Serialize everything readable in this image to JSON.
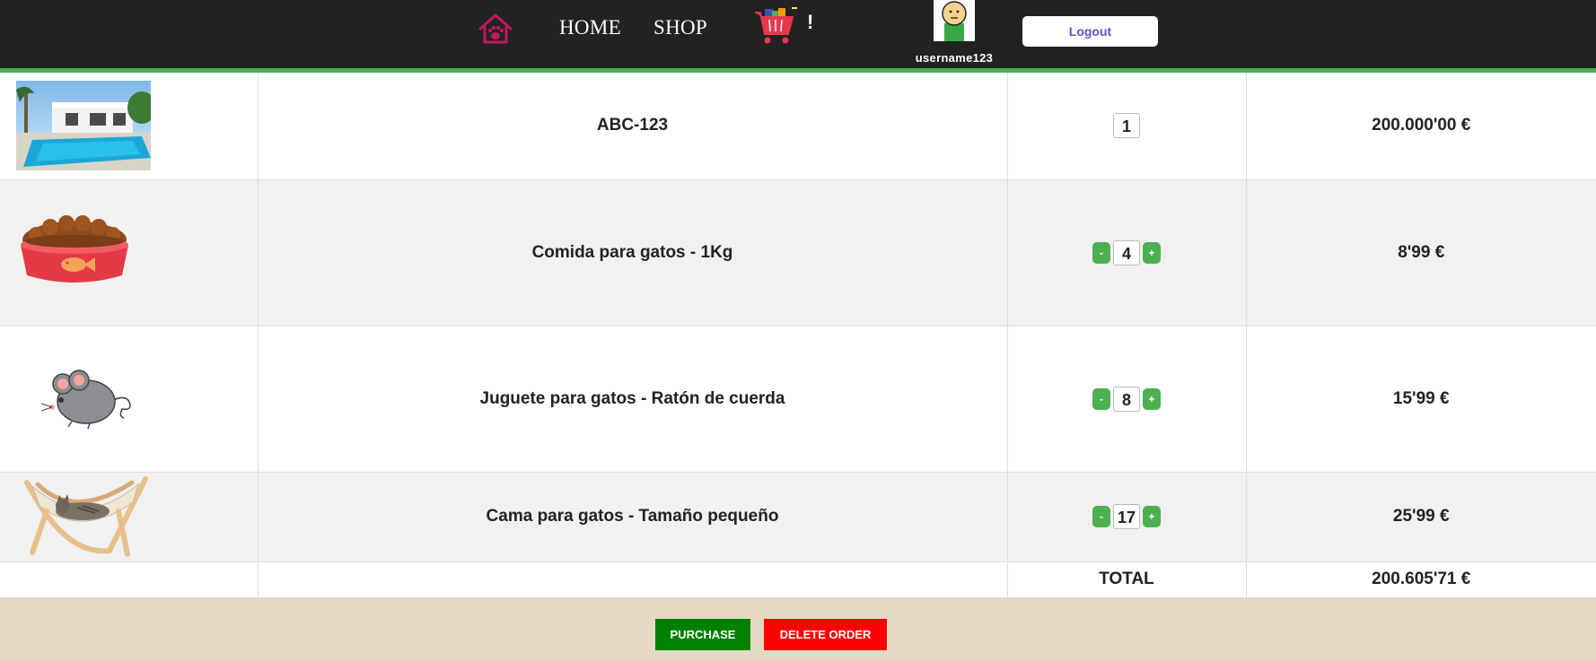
{
  "nav": {
    "logo_icon": "home-paw-icon",
    "home_label": "HOME",
    "shop_label": "SHOP",
    "cart_icon": "shopping-cart-icon",
    "cart_alert": "!",
    "username": "username123",
    "logout_label": "Logout"
  },
  "cart": {
    "items": [
      {
        "image": "pool-house-image",
        "name": "ABC-123",
        "quantity": "1",
        "price": "200.000'00 €",
        "editable": false
      },
      {
        "image": "cat-food-bowl-image",
        "name": "Comida para gatos - 1Kg",
        "quantity": "4",
        "price": "8'99 €",
        "editable": true
      },
      {
        "image": "toy-mouse-image",
        "name": "Juguete para gatos - Ratón de cuerda",
        "quantity": "8",
        "price": "15'99 €",
        "editable": true
      },
      {
        "image": "cat-hammock-image",
        "name": "Cama para gatos - Tamaño pequeño",
        "quantity": "17",
        "price": "25'99 €",
        "editable": true
      }
    ],
    "decrement_label": "-",
    "increment_label": "+",
    "total_label": "TOTAL",
    "total_value": "200.605'71 €"
  },
  "footer": {
    "purchase_label": "PURCHASE",
    "delete_label": "DELETE ORDER"
  },
  "colors": {
    "nav_bg": "#222222",
    "accent_green": "#4caf50",
    "purchase_green": "#008000",
    "delete_red": "#ff0000",
    "footer_bg": "#e4dac3",
    "logout_text": "#6a4cc9"
  }
}
